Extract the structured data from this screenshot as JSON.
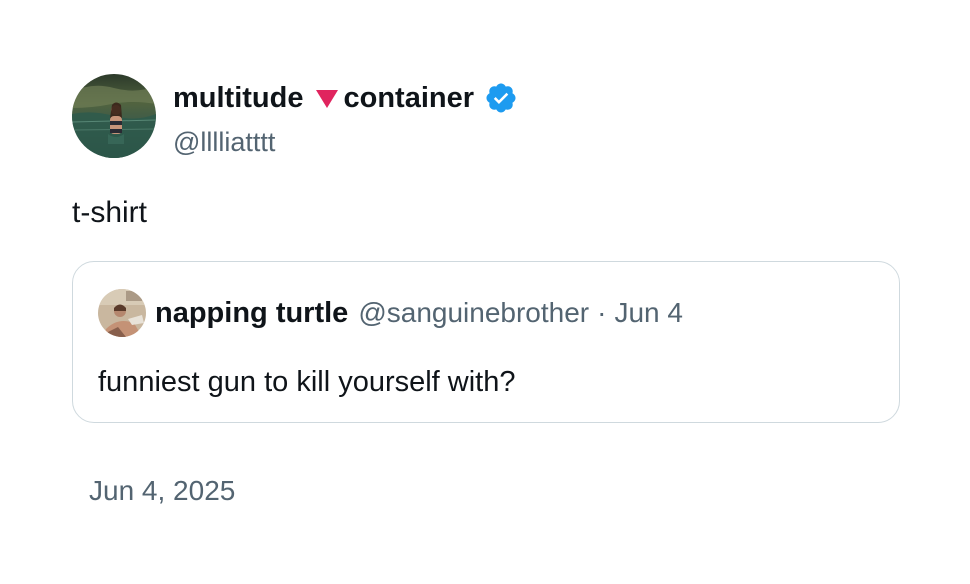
{
  "author": {
    "name_part1": "multitude",
    "name_part2": "container",
    "name_emoji": "red-down-triangle-icon",
    "verified": true,
    "verified_color": "#1d9bf0",
    "handle": "@lllliatttt"
  },
  "tweet": {
    "text": "t-shirt",
    "date": "Jun 4, 2025"
  },
  "quoted_tweet": {
    "author_name": "napping turtle",
    "handle": "@sanguinebrother",
    "separator": "·",
    "date": "Jun 4",
    "text": "funniest gun to kill yourself with?"
  },
  "colors": {
    "text_primary": "#0f1419",
    "text_secondary": "#536471",
    "border": "#cfd9de",
    "triangle": "#e0245e"
  }
}
